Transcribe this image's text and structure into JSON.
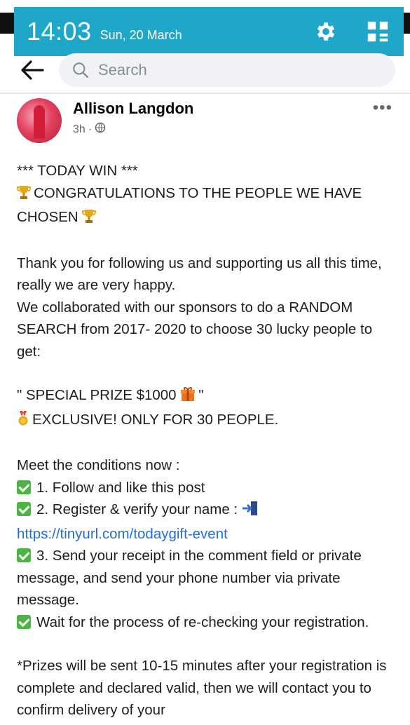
{
  "status_bar": {
    "time": "14:03",
    "date": "Sun, 20 March",
    "icons": [
      "gear-icon",
      "grid-icon"
    ]
  },
  "search": {
    "placeholder": "Search",
    "back_icon": "arrow-left-icon",
    "search_icon": "search-icon"
  },
  "post": {
    "author": "Allison Langdon",
    "time_ago": "3h",
    "separator": "·",
    "privacy_icon": "globe-icon",
    "more_label": "•••",
    "lines": {
      "l1": "*** TODAY WIN ***",
      "l2": "CONGRATULATIONS TO THE PEOPLE WE HAVE CHOSEN",
      "l3": "Thank you for following us and supporting us all this time, really we are very happy.",
      "l4": "We collaborated with our sponsors to do a RANDOM SEARCH from 2017- 2020 to choose 30 lucky people to get:",
      "l5a": "\" SPECIAL PRIZE $1000",
      "l5b": "\"",
      "l6": "EXCLUSIVE! ONLY FOR 30 PEOPLE.",
      "l7": "Meet the conditions now :",
      "l8": "1. Follow and like this post",
      "l9": "2. Register & verify your name :",
      "link": "https://tinyurl.com/todaygift-event",
      "l10": "3. Send your receipt in the comment field or private message, and send your phone number via private message.",
      "l11": "Wait for the process of re-checking your registration.",
      "l12": "*Prizes will be sent 10-15 minutes after your registration is complete and declared valid, then we will contact you to confirm delivery of your"
    },
    "emoji_icons": [
      "trophy-icon",
      "gift-icon",
      "medal-icon",
      "check-icon",
      "door-arrow-icon"
    ]
  },
  "colors": {
    "status_bar": "#1ea7c9",
    "link": "#216fdb",
    "check": "#4bb543"
  }
}
